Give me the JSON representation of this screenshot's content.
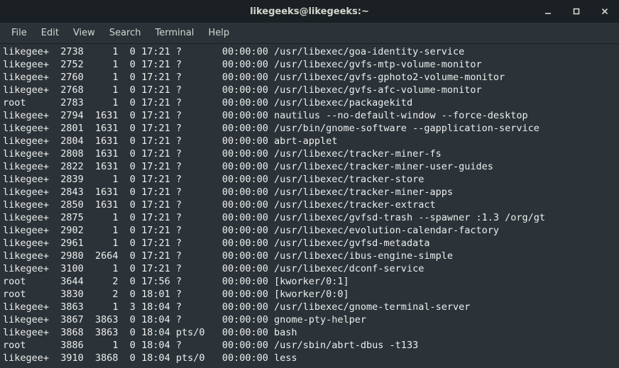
{
  "window": {
    "title": "likegeeks@likegeeks:~"
  },
  "menu": {
    "file": "File",
    "edit": "Edit",
    "view": "View",
    "search": "Search",
    "terminal": "Terminal",
    "help": "Help"
  },
  "processes": [
    {
      "user": "likegee+",
      "pid": "2738",
      "ppid": "1",
      "c": "0",
      "stime": "17:21",
      "tty": "?",
      "time": "00:00:00",
      "cmd": "/usr/libexec/goa-identity-service"
    },
    {
      "user": "likegee+",
      "pid": "2752",
      "ppid": "1",
      "c": "0",
      "stime": "17:21",
      "tty": "?",
      "time": "00:00:00",
      "cmd": "/usr/libexec/gvfs-mtp-volume-monitor"
    },
    {
      "user": "likegee+",
      "pid": "2760",
      "ppid": "1",
      "c": "0",
      "stime": "17:21",
      "tty": "?",
      "time": "00:00:00",
      "cmd": "/usr/libexec/gvfs-gphoto2-volume-monitor"
    },
    {
      "user": "likegee+",
      "pid": "2768",
      "ppid": "1",
      "c": "0",
      "stime": "17:21",
      "tty": "?",
      "time": "00:00:00",
      "cmd": "/usr/libexec/gvfs-afc-volume-monitor"
    },
    {
      "user": "root",
      "pid": "2783",
      "ppid": "1",
      "c": "0",
      "stime": "17:21",
      "tty": "?",
      "time": "00:00:00",
      "cmd": "/usr/libexec/packagekitd"
    },
    {
      "user": "likegee+",
      "pid": "2794",
      "ppid": "1631",
      "c": "0",
      "stime": "17:21",
      "tty": "?",
      "time": "00:00:00",
      "cmd": "nautilus --no-default-window --force-desktop"
    },
    {
      "user": "likegee+",
      "pid": "2801",
      "ppid": "1631",
      "c": "0",
      "stime": "17:21",
      "tty": "?",
      "time": "00:00:00",
      "cmd": "/usr/bin/gnome-software --gapplication-service"
    },
    {
      "user": "likegee+",
      "pid": "2804",
      "ppid": "1631",
      "c": "0",
      "stime": "17:21",
      "tty": "?",
      "time": "00:00:00",
      "cmd": "abrt-applet"
    },
    {
      "user": "likegee+",
      "pid": "2808",
      "ppid": "1631",
      "c": "0",
      "stime": "17:21",
      "tty": "?",
      "time": "00:00:00",
      "cmd": "/usr/libexec/tracker-miner-fs"
    },
    {
      "user": "likegee+",
      "pid": "2822",
      "ppid": "1631",
      "c": "0",
      "stime": "17:21",
      "tty": "?",
      "time": "00:00:00",
      "cmd": "/usr/libexec/tracker-miner-user-guides"
    },
    {
      "user": "likegee+",
      "pid": "2839",
      "ppid": "1",
      "c": "0",
      "stime": "17:21",
      "tty": "?",
      "time": "00:00:00",
      "cmd": "/usr/libexec/tracker-store"
    },
    {
      "user": "likegee+",
      "pid": "2843",
      "ppid": "1631",
      "c": "0",
      "stime": "17:21",
      "tty": "?",
      "time": "00:00:00",
      "cmd": "/usr/libexec/tracker-miner-apps"
    },
    {
      "user": "likegee+",
      "pid": "2850",
      "ppid": "1631",
      "c": "0",
      "stime": "17:21",
      "tty": "?",
      "time": "00:00:00",
      "cmd": "/usr/libexec/tracker-extract"
    },
    {
      "user": "likegee+",
      "pid": "2875",
      "ppid": "1",
      "c": "0",
      "stime": "17:21",
      "tty": "?",
      "time": "00:00:00",
      "cmd": "/usr/libexec/gvfsd-trash --spawner :1.3 /org/gt"
    },
    {
      "user": "likegee+",
      "pid": "2902",
      "ppid": "1",
      "c": "0",
      "stime": "17:21",
      "tty": "?",
      "time": "00:00:00",
      "cmd": "/usr/libexec/evolution-calendar-factory"
    },
    {
      "user": "likegee+",
      "pid": "2961",
      "ppid": "1",
      "c": "0",
      "stime": "17:21",
      "tty": "?",
      "time": "00:00:00",
      "cmd": "/usr/libexec/gvfsd-metadata"
    },
    {
      "user": "likegee+",
      "pid": "2980",
      "ppid": "2664",
      "c": "0",
      "stime": "17:21",
      "tty": "?",
      "time": "00:00:00",
      "cmd": "/usr/libexec/ibus-engine-simple"
    },
    {
      "user": "likegee+",
      "pid": "3100",
      "ppid": "1",
      "c": "0",
      "stime": "17:21",
      "tty": "?",
      "time": "00:00:00",
      "cmd": "/usr/libexec/dconf-service"
    },
    {
      "user": "root",
      "pid": "3644",
      "ppid": "2",
      "c": "0",
      "stime": "17:56",
      "tty": "?",
      "time": "00:00:00",
      "cmd": "[kworker/0:1]"
    },
    {
      "user": "root",
      "pid": "3830",
      "ppid": "2",
      "c": "0",
      "stime": "18:01",
      "tty": "?",
      "time": "00:00:00",
      "cmd": "[kworker/0:0]"
    },
    {
      "user": "likegee+",
      "pid": "3863",
      "ppid": "1",
      "c": "3",
      "stime": "18:04",
      "tty": "?",
      "time": "00:00:00",
      "cmd": "/usr/libexec/gnome-terminal-server"
    },
    {
      "user": "likegee+",
      "pid": "3867",
      "ppid": "3863",
      "c": "0",
      "stime": "18:04",
      "tty": "?",
      "time": "00:00:00",
      "cmd": "gnome-pty-helper"
    },
    {
      "user": "likegee+",
      "pid": "3868",
      "ppid": "3863",
      "c": "0",
      "stime": "18:04",
      "tty": "pts/0",
      "time": "00:00:00",
      "cmd": "bash"
    },
    {
      "user": "root",
      "pid": "3886",
      "ppid": "1",
      "c": "0",
      "stime": "18:04",
      "tty": "?",
      "time": "00:00:00",
      "cmd": "/usr/sbin/abrt-dbus -t133"
    },
    {
      "user": "likegee+",
      "pid": "3910",
      "ppid": "3868",
      "c": "0",
      "stime": "18:04",
      "tty": "pts/0",
      "time": "00:00:00",
      "cmd": "less"
    }
  ]
}
